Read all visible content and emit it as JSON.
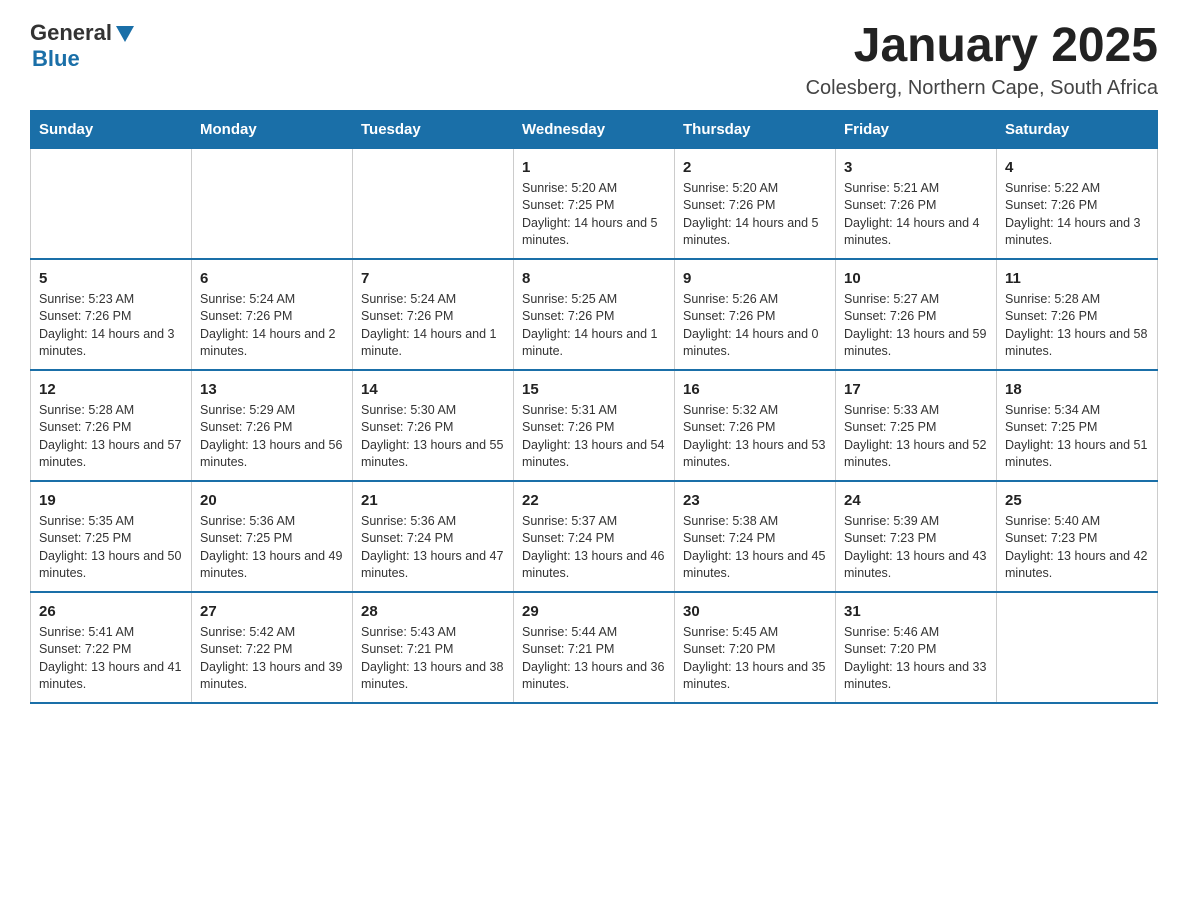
{
  "header": {
    "logo_general": "General",
    "logo_blue": "Blue",
    "month_title": "January 2025",
    "location": "Colesberg, Northern Cape, South Africa"
  },
  "weekdays": [
    "Sunday",
    "Monday",
    "Tuesday",
    "Wednesday",
    "Thursday",
    "Friday",
    "Saturday"
  ],
  "weeks": [
    [
      {
        "day": "",
        "info": ""
      },
      {
        "day": "",
        "info": ""
      },
      {
        "day": "",
        "info": ""
      },
      {
        "day": "1",
        "info": "Sunrise: 5:20 AM\nSunset: 7:25 PM\nDaylight: 14 hours and 5 minutes."
      },
      {
        "day": "2",
        "info": "Sunrise: 5:20 AM\nSunset: 7:26 PM\nDaylight: 14 hours and 5 minutes."
      },
      {
        "day": "3",
        "info": "Sunrise: 5:21 AM\nSunset: 7:26 PM\nDaylight: 14 hours and 4 minutes."
      },
      {
        "day": "4",
        "info": "Sunrise: 5:22 AM\nSunset: 7:26 PM\nDaylight: 14 hours and 3 minutes."
      }
    ],
    [
      {
        "day": "5",
        "info": "Sunrise: 5:23 AM\nSunset: 7:26 PM\nDaylight: 14 hours and 3 minutes."
      },
      {
        "day": "6",
        "info": "Sunrise: 5:24 AM\nSunset: 7:26 PM\nDaylight: 14 hours and 2 minutes."
      },
      {
        "day": "7",
        "info": "Sunrise: 5:24 AM\nSunset: 7:26 PM\nDaylight: 14 hours and 1 minute."
      },
      {
        "day": "8",
        "info": "Sunrise: 5:25 AM\nSunset: 7:26 PM\nDaylight: 14 hours and 1 minute."
      },
      {
        "day": "9",
        "info": "Sunrise: 5:26 AM\nSunset: 7:26 PM\nDaylight: 14 hours and 0 minutes."
      },
      {
        "day": "10",
        "info": "Sunrise: 5:27 AM\nSunset: 7:26 PM\nDaylight: 13 hours and 59 minutes."
      },
      {
        "day": "11",
        "info": "Sunrise: 5:28 AM\nSunset: 7:26 PM\nDaylight: 13 hours and 58 minutes."
      }
    ],
    [
      {
        "day": "12",
        "info": "Sunrise: 5:28 AM\nSunset: 7:26 PM\nDaylight: 13 hours and 57 minutes."
      },
      {
        "day": "13",
        "info": "Sunrise: 5:29 AM\nSunset: 7:26 PM\nDaylight: 13 hours and 56 minutes."
      },
      {
        "day": "14",
        "info": "Sunrise: 5:30 AM\nSunset: 7:26 PM\nDaylight: 13 hours and 55 minutes."
      },
      {
        "day": "15",
        "info": "Sunrise: 5:31 AM\nSunset: 7:26 PM\nDaylight: 13 hours and 54 minutes."
      },
      {
        "day": "16",
        "info": "Sunrise: 5:32 AM\nSunset: 7:26 PM\nDaylight: 13 hours and 53 minutes."
      },
      {
        "day": "17",
        "info": "Sunrise: 5:33 AM\nSunset: 7:25 PM\nDaylight: 13 hours and 52 minutes."
      },
      {
        "day": "18",
        "info": "Sunrise: 5:34 AM\nSunset: 7:25 PM\nDaylight: 13 hours and 51 minutes."
      }
    ],
    [
      {
        "day": "19",
        "info": "Sunrise: 5:35 AM\nSunset: 7:25 PM\nDaylight: 13 hours and 50 minutes."
      },
      {
        "day": "20",
        "info": "Sunrise: 5:36 AM\nSunset: 7:25 PM\nDaylight: 13 hours and 49 minutes."
      },
      {
        "day": "21",
        "info": "Sunrise: 5:36 AM\nSunset: 7:24 PM\nDaylight: 13 hours and 47 minutes."
      },
      {
        "day": "22",
        "info": "Sunrise: 5:37 AM\nSunset: 7:24 PM\nDaylight: 13 hours and 46 minutes."
      },
      {
        "day": "23",
        "info": "Sunrise: 5:38 AM\nSunset: 7:24 PM\nDaylight: 13 hours and 45 minutes."
      },
      {
        "day": "24",
        "info": "Sunrise: 5:39 AM\nSunset: 7:23 PM\nDaylight: 13 hours and 43 minutes."
      },
      {
        "day": "25",
        "info": "Sunrise: 5:40 AM\nSunset: 7:23 PM\nDaylight: 13 hours and 42 minutes."
      }
    ],
    [
      {
        "day": "26",
        "info": "Sunrise: 5:41 AM\nSunset: 7:22 PM\nDaylight: 13 hours and 41 minutes."
      },
      {
        "day": "27",
        "info": "Sunrise: 5:42 AM\nSunset: 7:22 PM\nDaylight: 13 hours and 39 minutes."
      },
      {
        "day": "28",
        "info": "Sunrise: 5:43 AM\nSunset: 7:21 PM\nDaylight: 13 hours and 38 minutes."
      },
      {
        "day": "29",
        "info": "Sunrise: 5:44 AM\nSunset: 7:21 PM\nDaylight: 13 hours and 36 minutes."
      },
      {
        "day": "30",
        "info": "Sunrise: 5:45 AM\nSunset: 7:20 PM\nDaylight: 13 hours and 35 minutes."
      },
      {
        "day": "31",
        "info": "Sunrise: 5:46 AM\nSunset: 7:20 PM\nDaylight: 13 hours and 33 minutes."
      },
      {
        "day": "",
        "info": ""
      }
    ]
  ]
}
